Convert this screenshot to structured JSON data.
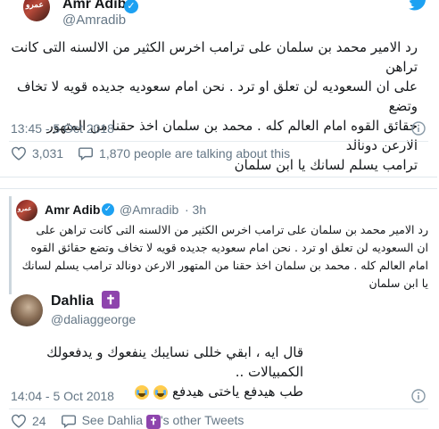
{
  "tweet1": {
    "name": "Amr Adib",
    "handle": "@Amradib",
    "avatar_text": "عمرو",
    "lines": [
      "رد الامير محمد بن سلمان على ترامب اخرس الكثير من الالسنه التى كانت تراهن",
      "على ان السعوديه لن تعلق او ترد . نحن امام سعوديه جديده قويه لا تخاف وتضع",
      "حقائق القوه امام العالم كله . محمد بن سلمان اخذ حقنا من المتهور الارعن دونالد",
      "ترامب يسلم لسانك يا ابن سلمان"
    ],
    "timestamp": "13:45 - 5 Oct 2018",
    "likes": "3,031",
    "talking": "1,870 people are talking about this"
  },
  "tweet2": {
    "quoted": {
      "name": "Amr Adib",
      "handle": "@Amradib",
      "time": "· 3h",
      "avatar_text": "عمرو",
      "lines": [
        "رد الامير محمد بن سلمان على ترامب اخرس الكثير من الالسنه التى كانت تراهن على",
        "ان السعوديه لن تعلق او ترد . نحن امام سعوديه جديده قويه لا تخاف وتضع حقائق القوه",
        "امام العالم كله . محمد بن سلمان اخذ حقنا من المتهور الارعن دونالد ترامب يسلم لسانك",
        "يا ابن سلمان"
      ]
    },
    "name": "Dahlia",
    "handle": "@daliaggeorge",
    "badge": "✝",
    "lines": [
      "قال ايه ، ابقي خللى نسايبك ينفعوك و يدفعولك الكمبيالات ..",
      "طب هيدفع ياختى هيدفع"
    ],
    "timestamp": "14:04 - 5 Oct 2018",
    "likes": "24",
    "see_prefix": "See Dahlia",
    "see_suffix": "'s other Tweets"
  },
  "icons": {
    "verified": "verified-badge-icon",
    "bird": "twitter-bird-icon",
    "like": "heart-icon",
    "comment": "speech-bubble-icon",
    "info": "info-icon"
  },
  "colors": {
    "twitter_blue": "#1da1f2",
    "meta_gray": "#657786",
    "badge_purple": "#8e44ad"
  }
}
